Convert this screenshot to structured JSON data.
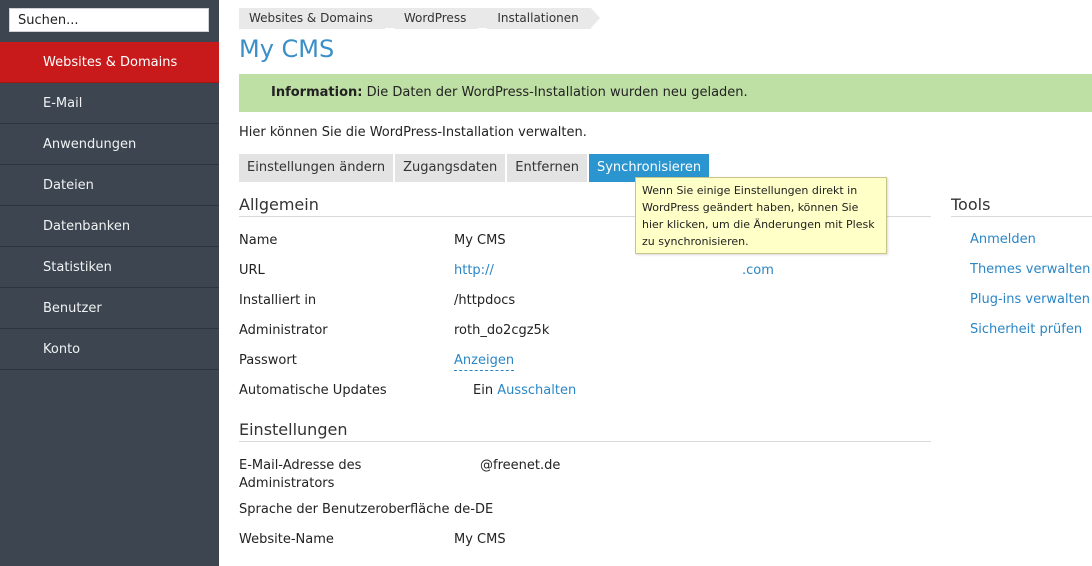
{
  "sidebar": {
    "search_placeholder": "Suchen...",
    "items": [
      {
        "label": "Websites & Domains",
        "active": true
      },
      {
        "label": "E-Mail"
      },
      {
        "label": "Anwendungen"
      },
      {
        "label": "Dateien"
      },
      {
        "label": "Datenbanken"
      },
      {
        "label": "Statistiken"
      },
      {
        "label": "Benutzer"
      },
      {
        "label": "Konto"
      }
    ]
  },
  "breadcrumb": [
    "Websites & Domains",
    "WordPress",
    "Installationen"
  ],
  "page_title": "My CMS",
  "info": {
    "label": "Information:",
    "text": "Die Daten der WordPress-Installation wurden neu geladen."
  },
  "intro": "Hier können Sie die WordPress-Installation verwalten.",
  "tabs": [
    {
      "label": "Einstellungen ändern"
    },
    {
      "label": "Zugangsdaten"
    },
    {
      "label": "Entfernen"
    },
    {
      "label": "Synchronisieren",
      "active": true
    }
  ],
  "tooltip": {
    "lines": [
      "Wenn Sie einige Einstellungen direkt in",
      "WordPress geändert haben, können Sie",
      "hier klicken, um die Änderungen mit Plesk",
      "zu synchronisieren."
    ]
  },
  "general": {
    "heading": "Allgemein",
    "name_label": "Name",
    "name_value": "My CMS",
    "url_label": "URL",
    "url_prefix": "http://",
    "url_suffix": ".com",
    "installed_label": "Installiert in",
    "installed_value": "/httpdocs",
    "admin_label": "Administrator",
    "admin_value": "roth_do2cgz5k",
    "password_label": "Passwort",
    "password_link": "Anzeigen",
    "updates_label": "Automatische Updates",
    "updates_value": "Ein",
    "updates_link": "Ausschalten"
  },
  "settings": {
    "heading": "Einstellungen",
    "email_label_1": "E-Mail-Adresse des",
    "email_label_2": "Administrators",
    "email_value": "@freenet.de",
    "lang_label": "Sprache der Benutzeroberfläche",
    "lang_value": "de-DE",
    "site_label": "Website-Name",
    "site_value": "My CMS"
  },
  "tools": {
    "heading": "Tools",
    "links": [
      "Anmelden",
      "Themes verwalten",
      "Plug-ins verwalten",
      "Sicherheit prüfen"
    ]
  },
  "colors": {
    "sidebar_bg": "#3c4550",
    "active_nav": "#c81a1a",
    "title": "#3a8fc8",
    "info_bg": "#bfe0a5",
    "tab_active": "#2a95cf",
    "link": "#2a86c6",
    "tooltip_bg": "#ffffc8"
  }
}
